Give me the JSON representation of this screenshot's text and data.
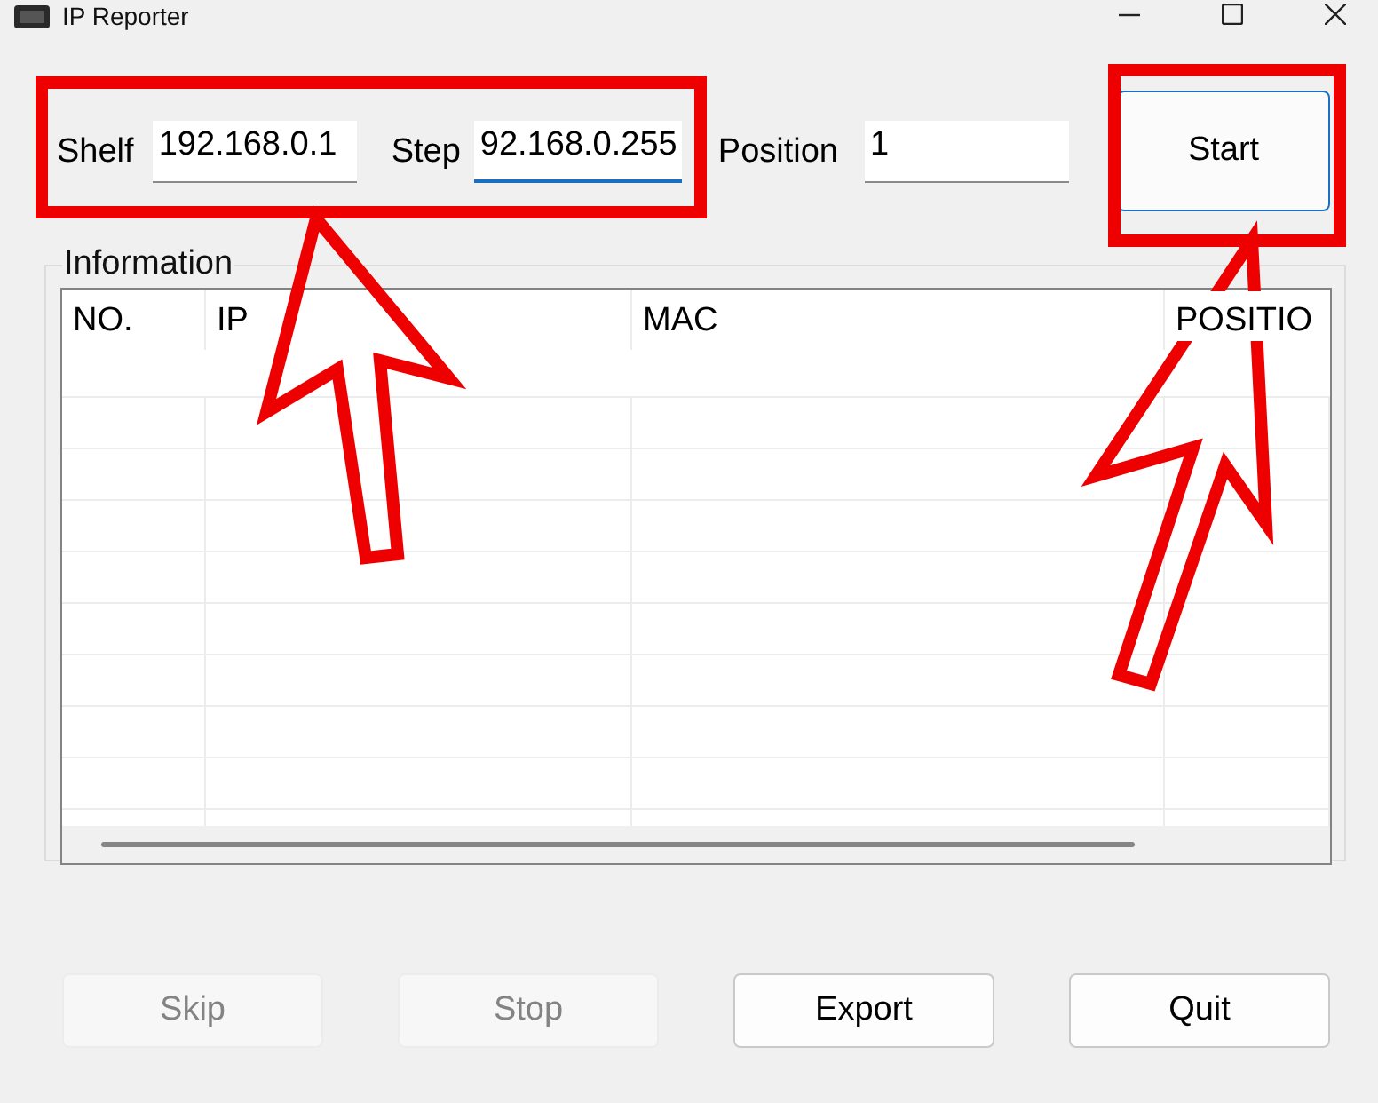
{
  "window": {
    "title": "IP Reporter"
  },
  "fields": [
    {
      "label": "Shelf",
      "value": "192.168.0.1",
      "focused": false
    },
    {
      "label": "Step",
      "value": "92.168.0.255",
      "focused": true
    },
    {
      "label": "Position",
      "value": "1",
      "focused": false
    }
  ],
  "start_button": {
    "label": "Start",
    "focused": true
  },
  "information": {
    "title": "Information",
    "columns": [
      "NO.",
      "IP",
      "MAC",
      "POSITIO"
    ]
  },
  "buttons": [
    {
      "label": "Skip",
      "disabled": true
    },
    {
      "label": "Stop",
      "disabled": true
    },
    {
      "label": "Export",
      "disabled": false
    },
    {
      "label": "Quit",
      "disabled": false
    }
  ]
}
